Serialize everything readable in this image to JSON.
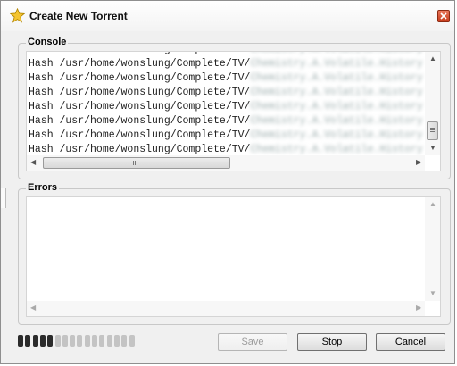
{
  "window": {
    "title": "Create New Torrent",
    "star_color": "#f4c430",
    "close_color": "#d9472a"
  },
  "console": {
    "label": "Console",
    "lines": [
      "Hash /usr/home/wonslung/Complete/TV/",
      "Hash /usr/home/wonslung/Complete/TV/",
      "Hash /usr/home/wonslung/Complete/TV/",
      "Hash /usr/home/wonslung/Complete/TV/",
      "Hash /usr/home/wonslung/Complete/TV/",
      "Hash /usr/home/wonslung/Complete/TV/",
      "Hash /usr/home/wonslung/Complete/TV/",
      "Hash /usr/home/wonslung/Complete/TV/"
    ],
    "blurred_suffix": "Chemistry.A.Volatile.History"
  },
  "errors": {
    "label": "Errors"
  },
  "progress": {
    "filled_segments": 5,
    "total_segments": 16,
    "filled_color": "#2b2b2b",
    "empty_color": "#c4c4c4"
  },
  "buttons": {
    "save": "Save",
    "stop": "Stop",
    "cancel": "Cancel"
  }
}
